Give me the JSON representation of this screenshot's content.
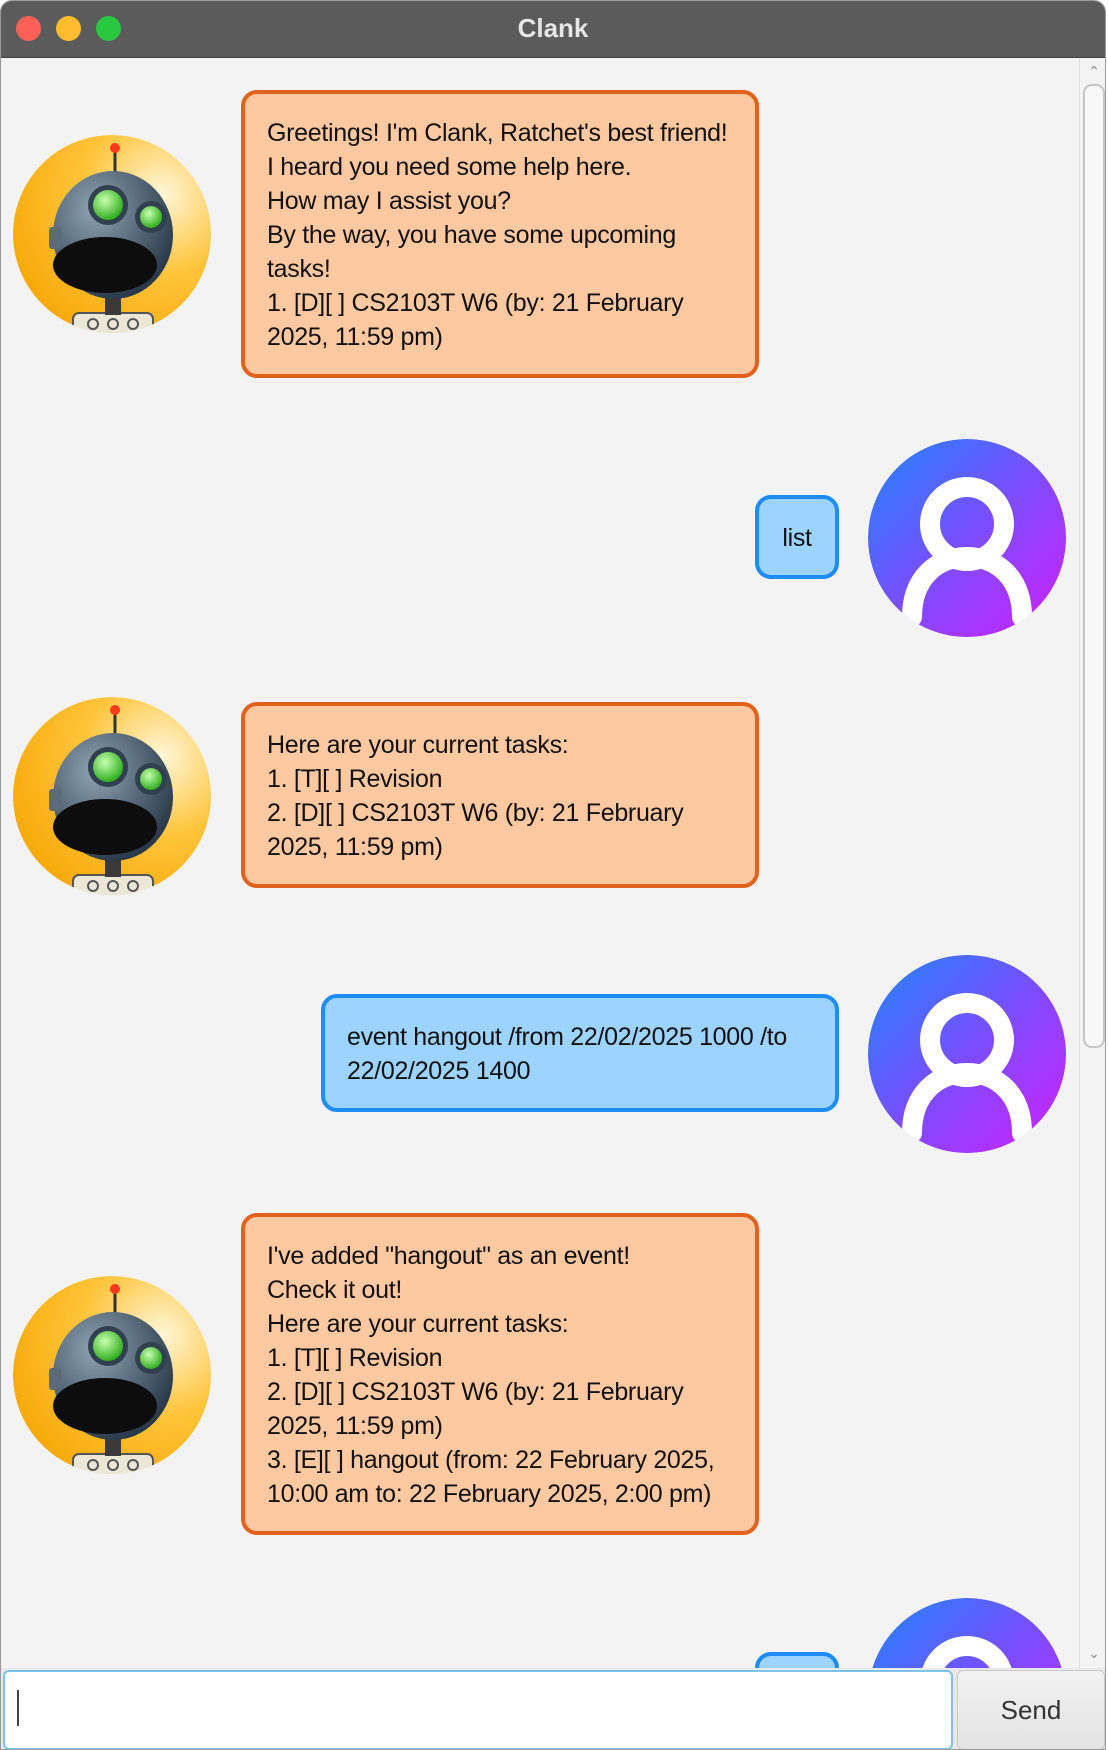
{
  "window": {
    "title": "Clank"
  },
  "messages": [
    {
      "sender": "bot",
      "text": "Greetings! I'm Clank, Ratchet's best friend!\nI heard you need some help here.\nHow may I assist you?\nBy the way, you have some upcoming tasks!\n1. [D][ ] CS2103T W6 (by: 21 February 2025, 11:59 pm)"
    },
    {
      "sender": "user",
      "text": "list"
    },
    {
      "sender": "bot",
      "text": "Here are your current tasks:\n1. [T][ ] Revision\n2. [D][ ] CS2103T W6 (by: 21 February 2025, 11:59 pm)"
    },
    {
      "sender": "user",
      "text": "event hangout /from 22/02/2025 1000 /to 22/02/2025 1400"
    },
    {
      "sender": "bot",
      "text": "I've added \"hangout\" as an event!\nCheck it out!\nHere are your current tasks:\n1. [T][ ] Revision\n2. [D][ ] CS2103T W6 (by: 21 February 2025, 11:59 pm)\n3. [E][ ] hangout (from: 22 February 2025, 10:00 am to: 22 February 2025, 2:00 pm)"
    }
  ],
  "input": {
    "value": "",
    "send_label": "Send"
  },
  "icons": {
    "bot_avatar": "robot-clank-icon",
    "user_avatar": "user-profile-icon"
  },
  "colors": {
    "bot_bubble_bg": "#fec8a1",
    "bot_bubble_border": "#e0621d",
    "user_bubble_bg": "#9dd3ff",
    "user_bubble_border": "#1e8cf5"
  }
}
